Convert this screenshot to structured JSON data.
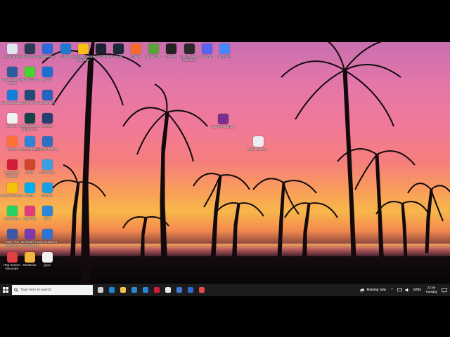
{
  "desktop": {
    "icons": [
      {
        "label": "Recycle Bin",
        "color": "#dfe6ee"
      },
      {
        "label": "Rockstar Games",
        "color": "#2d3a55"
      },
      {
        "label": "Steelseries",
        "color": "#2d6ad8"
      },
      {
        "label": "Outlast",
        "color": "#1e7ad1"
      },
      {
        "label": "Rockstar Games Launcher",
        "color": "#f8c012"
      },
      {
        "label": "Ubisoft Connect",
        "color": "#1a2232"
      },
      {
        "label": "Steam",
        "color": "#1b2838"
      },
      {
        "label": "Origin",
        "color": "#f56c2d"
      },
      {
        "label": "Minecraft",
        "color": "#5aa336"
      },
      {
        "label": "Unreal",
        "color": "#222222"
      },
      {
        "label": "Epic Games Launcher",
        "color": "#2a2a2a"
      },
      {
        "label": "Discord",
        "color": "#5865f2"
      },
      {
        "label": "NordVPN",
        "color": "#4687ff"
      },
      {
        "label": "TeamSpeak 3 Client",
        "color": "#2b5d9c"
      },
      {
        "label": "Razer Cortex",
        "color": "#44d62c"
      },
      {
        "label": "Photos",
        "color": "#1f6fd0"
      },
      {
        "label": "Microsoft Edge",
        "color": "#0f7fd9"
      },
      {
        "label": "IVsy VPN",
        "color": "#234b7a"
      },
      {
        "label": "Movies & TV",
        "color": "#2564c1"
      },
      {
        "label": "Gv Porn",
        "color": "#f2f2f2"
      },
      {
        "label": "Wondershare Filmora 11",
        "color": "#14424d"
      },
      {
        "label": "Camera",
        "color": "#233f73"
      },
      {
        "label": "Firefox",
        "color": "#ff7139"
      },
      {
        "label": "Microsoft Store",
        "color": "#2e84d6"
      },
      {
        "label": "Aliens All Clock",
        "color": "#2f6fbf"
      },
      {
        "label": "Opera GX Browser",
        "color": "#d21d3a"
      },
      {
        "label": "Office",
        "color": "#d0462a"
      },
      {
        "label": "3D Viewer",
        "color": "#3ba0e0"
      },
      {
        "label": "Google Chrome",
        "color": "#f4c20d"
      },
      {
        "label": "Skype",
        "color": "#00aff0"
      },
      {
        "label": "Cortana",
        "color": "#1a9ee8"
      },
      {
        "label": "WhatsApp",
        "color": "#25d366"
      },
      {
        "label": "Paint 3D",
        "color": "#e13c7b"
      },
      {
        "label": "Mail",
        "color": "#2a86d8"
      },
      {
        "label": "Auto Pilot Recorder",
        "color": "#3c57a8"
      },
      {
        "label": "OneNote for Windows 10",
        "color": "#7b3bb0"
      },
      {
        "label": "Snip & Sketch",
        "color": "#2f76d4"
      },
      {
        "label": "iTop Screen Recorder",
        "color": "#e43f45"
      },
      {
        "label": "OneDrive",
        "color": "#f0b73c"
      },
      {
        "label": "guys",
        "color": "#f1f1f1"
      },
      {
        "label": "WinRAR archive",
        "color": "#7a2f8e"
      },
      {
        "label": "New Text Do...",
        "color": "#e9eef3"
      }
    ]
  },
  "taskbar": {
    "search_placeholder": "Type here to search",
    "apps": [
      {
        "name": "task-view",
        "color": "#cfcfcf"
      },
      {
        "name": "edge",
        "color": "#1e89d9"
      },
      {
        "name": "file-explorer",
        "color": "#f1c24a"
      },
      {
        "name": "store",
        "color": "#2e84d6"
      },
      {
        "name": "mail",
        "color": "#2a86d8"
      },
      {
        "name": "opera",
        "color": "#d21d3a"
      },
      {
        "name": "notes",
        "color": "#e9e9e9"
      },
      {
        "name": "tool",
        "color": "#3e7bd4"
      },
      {
        "name": "security",
        "color": "#2f6ad1"
      },
      {
        "name": "recorder",
        "color": "#e54a4a"
      }
    ],
    "weather_text": "Raining now",
    "language": "ENG",
    "time": "22:56",
    "day": "Tuesday"
  }
}
